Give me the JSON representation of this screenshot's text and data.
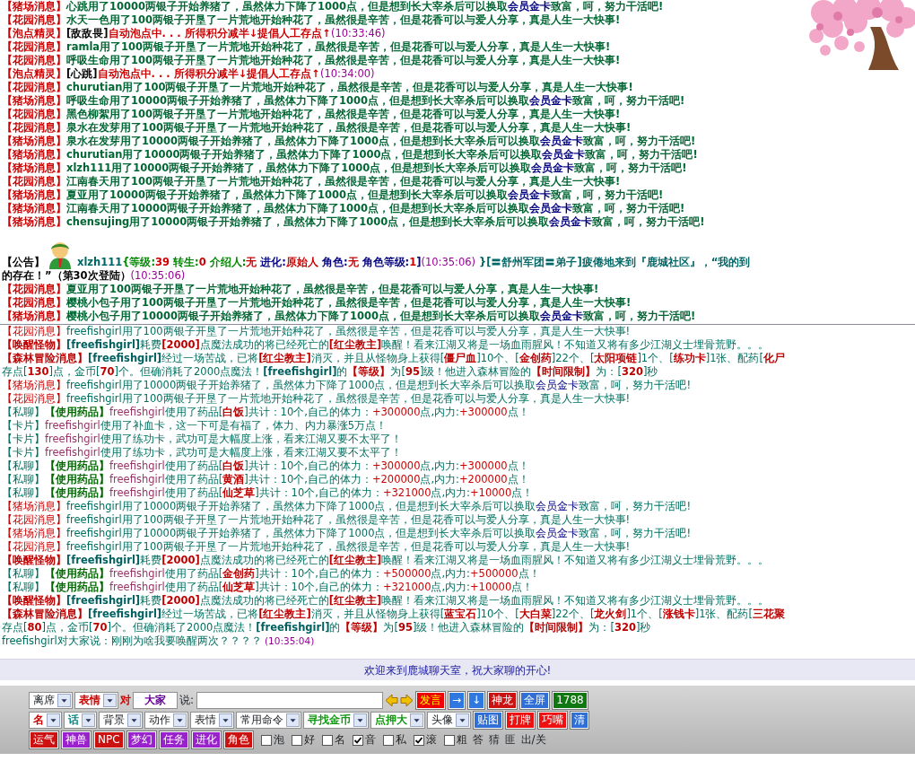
{
  "top_panel": {
    "items": [
      {
        "kind": "message",
        "parts": [
          {
            "text": "【猪场消息】",
            "kind": "tag"
          },
          {
            "text": "心跳用了10000两银子开始养猪了，虽然体力下降了1000点，但是想到长大宰杀后可以换取",
            "kind": "text"
          },
          {
            "text": "会员金卡",
            "kind": "gold"
          },
          {
            "text": "致富，呵，努力干活吧!",
            "kind": "text"
          }
        ]
      },
      {
        "kind": "message",
        "parts": [
          {
            "text": "【花园消息】",
            "kind": "tag"
          },
          {
            "text": "水天一色用了100两银子开垦了一片荒地开始种花了，虽然很是辛苦，但是花香可以与爱人分享，真是人生一大快事!",
            "kind": "text"
          }
        ]
      },
      {
        "kind": "message",
        "parts": [
          {
            "text": "【泡点精灵】",
            "kind": "tag"
          },
          {
            "text": "[敌敌畏]",
            "kind": "name"
          },
          {
            "text": "自动泡点中. . . 所得积分减半↓提倡人工存点↑",
            "kind": "alert"
          },
          {
            "text": "(10:33:46)",
            "kind": "time"
          }
        ]
      },
      {
        "kind": "message",
        "parts": [
          {
            "text": "【花园消息】",
            "kind": "tag"
          },
          {
            "text": "ramla用了100两银子开垦了一片荒地开始种花了，虽然很是辛苦，但是花香可以与爱人分享，真是人生一大快事!",
            "kind": "text"
          }
        ]
      },
      {
        "kind": "message",
        "parts": [
          {
            "text": "【花园消息】",
            "kind": "tag"
          },
          {
            "text": "呼吸生命用了100两银子开垦了一片荒地开始种花了，虽然很是辛苦，但是花香可以与爱人分享，真是人生一大快事!",
            "kind": "text"
          }
        ]
      },
      {
        "kind": "message",
        "parts": [
          {
            "text": "【泡点精灵】",
            "kind": "tag"
          },
          {
            "text": "[心跳]",
            "kind": "name"
          },
          {
            "text": "自动泡点中. . . 所得积分减半↓提倡人工存点↑",
            "kind": "alert"
          },
          {
            "text": "(10:34:00)",
            "kind": "time"
          }
        ]
      },
      {
        "kind": "message",
        "parts": [
          {
            "text": "【花园消息】",
            "kind": "tag"
          },
          {
            "text": "churutian用了100两银子开垦了一片荒地开始种花了，虽然很是辛苦，但是花香可以与爱人分享，真是人生一大快事!",
            "kind": "text"
          }
        ]
      },
      {
        "kind": "message",
        "parts": [
          {
            "text": "【猪场消息】",
            "kind": "tag"
          },
          {
            "text": "呼吸生命用了10000两银子开始养猪了，虽然体力下降了1000点，但是想到长大宰杀后可以换取",
            "kind": "text"
          },
          {
            "text": "会员金卡",
            "kind": "gold"
          },
          {
            "text": "致富，呵，努力干活吧!",
            "kind": "text"
          }
        ]
      },
      {
        "kind": "message",
        "parts": [
          {
            "text": "【花园消息】",
            "kind": "tag"
          },
          {
            "text": "黑色柳絮用了100两银子开垦了一片荒地开始种花了，虽然很是辛苦，但是花香可以与爱人分享，真是人生一大快事!",
            "kind": "text"
          }
        ]
      },
      {
        "kind": "message",
        "parts": [
          {
            "text": "【花园消息】",
            "kind": "tag"
          },
          {
            "text": "泉水在发芽用了100两银子开垦了一片荒地开始种花了，虽然很是辛苦，但是花香可以与爱人分享，真是人生一大快事!",
            "kind": "text"
          }
        ]
      },
      {
        "kind": "message",
        "parts": [
          {
            "text": "【猪场消息】",
            "kind": "tag"
          },
          {
            "text": "泉水在发芽用了10000两银子开始养猪了，虽然体力下降了1000点，但是想到长大宰杀后可以换取",
            "kind": "text"
          },
          {
            "text": "会员金卡",
            "kind": "gold"
          },
          {
            "text": "致富，呵，努力干活吧!",
            "kind": "text"
          }
        ]
      },
      {
        "kind": "message",
        "parts": [
          {
            "text": "【猪场消息】",
            "kind": "tag"
          },
          {
            "text": "churutian用了10000两银子开始养猪了，虽然体力下降了1000点，但是想到长大宰杀后可以换取",
            "kind": "text"
          },
          {
            "text": "会员金卡",
            "kind": "gold"
          },
          {
            "text": "致富，呵，努力干活吧!",
            "kind": "text"
          }
        ]
      },
      {
        "kind": "message",
        "parts": [
          {
            "text": "【猪场消息】",
            "kind": "tag"
          },
          {
            "text": "xlzh111用了10000两银子开始养猪了，虽然体力下降了1000点，但是想到长大宰杀后可以换取",
            "kind": "text"
          },
          {
            "text": "会员金卡",
            "kind": "gold"
          },
          {
            "text": "致富，呵，努力干活吧!",
            "kind": "text"
          }
        ]
      },
      {
        "kind": "message",
        "parts": [
          {
            "text": "【花园消息】",
            "kind": "tag"
          },
          {
            "text": "江南春天用了100两银子开垦了一片荒地开始种花了，虽然很是辛苦，但是花香可以与爱人分享，真是人生一大快事!",
            "kind": "text"
          }
        ]
      },
      {
        "kind": "message",
        "parts": [
          {
            "text": "【猪场消息】",
            "kind": "tag"
          },
          {
            "text": "夏亚用了10000两银子开始养猪了，虽然体力下降了1000点，但是想到长大宰杀后可以换取",
            "kind": "text"
          },
          {
            "text": "会员金卡",
            "kind": "gold"
          },
          {
            "text": "致富，呵，努力干活吧!",
            "kind": "text"
          }
        ]
      },
      {
        "kind": "message",
        "parts": [
          {
            "text": "【猪场消息】",
            "kind": "tag"
          },
          {
            "text": "江南春天用了10000两银子开始养猪了，虽然体力下降了1000点，但是想到长大宰杀后可以换取",
            "kind": "text"
          },
          {
            "text": "会员金卡",
            "kind": "gold"
          },
          {
            "text": "致富，呵，努力干活吧!",
            "kind": "text"
          }
        ]
      },
      {
        "kind": "message",
        "parts": [
          {
            "text": "【猪场消息】",
            "kind": "tag"
          },
          {
            "text": "chensujing用了10000两银子开始养猪了，虽然体力下降了1000点，但是想到长大宰杀后可以换取",
            "kind": "text"
          },
          {
            "text": "会员金卡",
            "kind": "gold"
          },
          {
            "text": "致富，呵，努力干活吧!",
            "kind": "text"
          }
        ]
      },
      {
        "kind": "announcement",
        "label": "【公告】",
        "lines": [
          {
            "parts": [
              {
                "text": "xlzh111",
                "kind": "user"
              },
              {
                "text": "{等级:",
                "kind": "label"
              },
              {
                "text": "39",
                "kind": "value"
              },
              {
                "text": " 转生:",
                "kind": "label"
              },
              {
                "text": "0",
                "kind": "value"
              },
              {
                "text": " 介绍人:",
                "kind": "label"
              },
              {
                "text": "无",
                "kind": "value"
              },
              {
                "text": " 进化:",
                "kind": "label2"
              },
              {
                "text": "原始人",
                "kind": "value"
              },
              {
                "text": " 角色:",
                "kind": "label2"
              },
              {
                "text": "无",
                "kind": "value"
              },
              {
                "text": " 角色等级:",
                "kind": "label2"
              },
              {
                "text": "1",
                "kind": "value"
              },
              {
                "text": "]",
                "kind": "label2"
              },
              {
                "text": "(10:35:06)",
                "kind": "time"
              },
              {
                "text": " }[〓舒州军团〓弟子]疲倦地来到『鹿城社区』，“我的到",
                "kind": "user"
              }
            ]
          },
          {
            "parts": [
              {
                "text": "的存在！”（第30次登陆）",
                "kind": "plain"
              },
              {
                "text": "(10:35:06)",
                "kind": "time"
              }
            ]
          }
        ]
      },
      {
        "kind": "message",
        "parts": [
          {
            "text": "【花园消息】",
            "kind": "tag"
          },
          {
            "text": "夏亚用了100两银子开垦了一片荒地开始种花了，虽然很是辛苦，但是花香可以与爱人分享，真是人生一大快事!",
            "kind": "text"
          }
        ]
      },
      {
        "kind": "message",
        "parts": [
          {
            "text": "【花园消息】",
            "kind": "tag"
          },
          {
            "text": "樱桃小包子用了100两银子开垦了一片荒地开始种花了，虽然很是辛苦，但是花香可以与爱人分享，真是人生一大快事!",
            "kind": "text"
          }
        ]
      },
      {
        "kind": "message",
        "parts": [
          {
            "text": "【猪场消息】",
            "kind": "tag"
          },
          {
            "text": "樱桃小包子用了10000两银子开始养猪了，虽然体力下降了1000点，但是想到长大宰杀后可以换取",
            "kind": "text"
          },
          {
            "text": "会员金卡",
            "kind": "gold"
          },
          {
            "text": "致富，呵，努力干活吧!",
            "kind": "text"
          }
        ]
      }
    ]
  },
  "chat_panel": {
    "messages": [
      {
        "parts": [
          {
            "text": "【花园消息】",
            "kind": "ltag"
          },
          {
            "text": "freefishgirl用了100两银子开垦了一片荒地开始种花了，虽然很是辛苦，但是花香可以与爱人分享，真是人生一大快事!",
            "kind": "ltext"
          }
        ]
      },
      {
        "parts": [
          {
            "text": "【唤醒怪物】",
            "kind": "lkey"
          },
          {
            "text": "[freefishgirl]",
            "kind": "lstrong"
          },
          {
            "text": "耗费",
            "kind": "ltext"
          },
          {
            "text": "[2000]",
            "kind": "lkey"
          },
          {
            "text": "点魔法成功的将已经死亡的",
            "kind": "ltext"
          },
          {
            "text": "[红尘教主]",
            "kind": "lkey"
          },
          {
            "text": "唤醒！看来江湖又将是一场血雨腥风！不知道又将有多少江湖义士埋骨荒野。。。",
            "kind": "ltext"
          }
        ]
      },
      {
        "parts": [
          {
            "text": "【森林冒险消息】",
            "kind": "lkey"
          },
          {
            "text": "[freefishgirl]",
            "kind": "lstrong"
          },
          {
            "text": "经过一场苦战，已将",
            "kind": "ltext"
          },
          {
            "text": "[红尘教主]",
            "kind": "lkey"
          },
          {
            "text": "消灭，并且从怪物身上获得[",
            "kind": "ltext"
          },
          {
            "text": "僵尸血",
            "kind": "lkey"
          },
          {
            "text": "]10个、[",
            "kind": "ltext"
          },
          {
            "text": "金创药",
            "kind": "lkey"
          },
          {
            "text": "]22个、[",
            "kind": "ltext"
          },
          {
            "text": "太阳项链",
            "kind": "lkey"
          },
          {
            "text": "]1个、[",
            "kind": "ltext"
          },
          {
            "text": "练功卡",
            "kind": "lkey"
          },
          {
            "text": "]1张、配药[",
            "kind": "ltext"
          },
          {
            "text": "化尸",
            "kind": "lkey"
          }
        ]
      },
      {
        "parts": [
          {
            "text": "存点[",
            "kind": "ltext"
          },
          {
            "text": "130",
            "kind": "lkey"
          },
          {
            "text": "]点，金币[",
            "kind": "ltext"
          },
          {
            "text": "70",
            "kind": "lkey"
          },
          {
            "text": "]个。但确消耗了2000点魔法！",
            "kind": "ltext"
          },
          {
            "text": "[freefishgirl]",
            "kind": "lstrong"
          },
          {
            "text": "的",
            "kind": "ltext"
          },
          {
            "text": "【等级】",
            "kind": "lkey"
          },
          {
            "text": "为[",
            "kind": "ltext"
          },
          {
            "text": "95",
            "kind": "lkey"
          },
          {
            "text": "]级！他进入森林冒险的",
            "kind": "ltext"
          },
          {
            "text": "【时间限制】",
            "kind": "lkey"
          },
          {
            "text": "为：[",
            "kind": "ltext"
          },
          {
            "text": "320",
            "kind": "lkey"
          },
          {
            "text": "]秒",
            "kind": "ltext"
          }
        ]
      },
      {
        "parts": [
          {
            "text": "【猪场消息】",
            "kind": "ltag"
          },
          {
            "text": "freefishgirl用了10000两银子开始养猪了，虽然体力下降了1000点，但是想到长大宰杀后可以换取",
            "kind": "ltext"
          },
          {
            "text": "会员金卡",
            "kind": "lgold"
          },
          {
            "text": "致富，呵，努力干活吧!",
            "kind": "ltext"
          }
        ]
      },
      {
        "parts": [
          {
            "text": "【花园消息】",
            "kind": "ltag"
          },
          {
            "text": "freefishgirl用了100两银子开垦了一片荒地开始种花了，虽然很是辛苦，但是花香可以与爱人分享，真是人生一大快事!",
            "kind": "ltext"
          }
        ]
      },
      {
        "parts": [
          {
            "text": "【私聊】",
            "kind": "ltext"
          },
          {
            "text": "【使用药品】",
            "kind": "lmed"
          },
          {
            "text": "freefishgirl",
            "kind": "lplayer"
          },
          {
            "text": "使用了药品[",
            "kind": "ltext"
          },
          {
            "text": "白饭",
            "kind": "lkey"
          },
          {
            "text": "]共计：10个,自己的体力：",
            "kind": "ltext"
          },
          {
            "text": "+300000",
            "kind": "lnum"
          },
          {
            "text": "点,内力:",
            "kind": "ltext"
          },
          {
            "text": "+300000",
            "kind": "lnum"
          },
          {
            "text": "点！",
            "kind": "ltext"
          }
        ]
      },
      {
        "parts": [
          {
            "text": "【卡片】",
            "kind": "ltext"
          },
          {
            "text": "freefishgirl",
            "kind": "lplayer"
          },
          {
            "text": "使用了补血卡，这一下可是有福了，体力、内力暴涨5万点！",
            "kind": "ltext"
          }
        ]
      },
      {
        "parts": [
          {
            "text": "【卡片】",
            "kind": "ltext"
          },
          {
            "text": "freefishgirl",
            "kind": "lplayer"
          },
          {
            "text": "使用了练功卡，武功可是大幅度上涨，看来江湖又要不太平了！",
            "kind": "ltext"
          }
        ]
      },
      {
        "parts": [
          {
            "text": "【卡片】",
            "kind": "ltext"
          },
          {
            "text": "freefishgirl",
            "kind": "lplayer"
          },
          {
            "text": "使用了练功卡，武功可是大幅度上涨，看来江湖又要不太平了！",
            "kind": "ltext"
          }
        ]
      },
      {
        "parts": [
          {
            "text": "【私聊】",
            "kind": "ltext"
          },
          {
            "text": "【使用药品】",
            "kind": "lmed"
          },
          {
            "text": "freefishgirl",
            "kind": "lplayer"
          },
          {
            "text": "使用了药品[",
            "kind": "ltext"
          },
          {
            "text": "白饭",
            "kind": "lkey"
          },
          {
            "text": "]共计：10个,自己的体力：",
            "kind": "ltext"
          },
          {
            "text": "+300000",
            "kind": "lnum"
          },
          {
            "text": "点,内力:",
            "kind": "ltext"
          },
          {
            "text": "+300000",
            "kind": "lnum"
          },
          {
            "text": "点！",
            "kind": "ltext"
          }
        ]
      },
      {
        "parts": [
          {
            "text": "【私聊】",
            "kind": "ltext"
          },
          {
            "text": "【使用药品】",
            "kind": "lmed"
          },
          {
            "text": "freefishgirl",
            "kind": "lplayer"
          },
          {
            "text": "使用了药品[",
            "kind": "ltext"
          },
          {
            "text": "黄酒",
            "kind": "lkey"
          },
          {
            "text": "]共计：10个,自己的体力：",
            "kind": "ltext"
          },
          {
            "text": "+200000",
            "kind": "lnum"
          },
          {
            "text": "点,内力:",
            "kind": "ltext"
          },
          {
            "text": "+200000",
            "kind": "lnum"
          },
          {
            "text": "点！",
            "kind": "ltext"
          }
        ]
      },
      {
        "parts": [
          {
            "text": "【私聊】",
            "kind": "ltext"
          },
          {
            "text": "【使用药品】",
            "kind": "lmed"
          },
          {
            "text": "freefishgirl",
            "kind": "lplayer"
          },
          {
            "text": "使用了药品[",
            "kind": "ltext"
          },
          {
            "text": "仙芝草",
            "kind": "lkey"
          },
          {
            "text": "]共计：10个,自己的体力：",
            "kind": "ltext"
          },
          {
            "text": "+321000",
            "kind": "lnum"
          },
          {
            "text": "点,内力:",
            "kind": "ltext"
          },
          {
            "text": "+10000",
            "kind": "lnum"
          },
          {
            "text": "点！",
            "kind": "ltext"
          }
        ]
      },
      {
        "parts": [
          {
            "text": "【猪场消息】",
            "kind": "ltag"
          },
          {
            "text": "freefishgirl用了10000两银子开始养猪了，虽然体力下降了1000点，但是想到长大宰杀后可以换取",
            "kind": "ltext"
          },
          {
            "text": "会员金卡",
            "kind": "lgold"
          },
          {
            "text": "致富，呵，努力干活吧!",
            "kind": "ltext"
          }
        ]
      },
      {
        "parts": [
          {
            "text": "【花园消息】",
            "kind": "ltag"
          },
          {
            "text": "freefishgirl用了100两银子开垦了一片荒地开始种花了，虽然很是辛苦，但是花香可以与爱人分享，真是人生一大快事!",
            "kind": "ltext"
          }
        ]
      },
      {
        "parts": [
          {
            "text": "【猪场消息】",
            "kind": "ltag"
          },
          {
            "text": "freefishgirl用了10000两银子开始养猪了，虽然体力下降了1000点，但是想到长大宰杀后可以换取",
            "kind": "ltext"
          },
          {
            "text": "会员金卡",
            "kind": "lgold"
          },
          {
            "text": "致富，呵，努力干活吧!",
            "kind": "ltext"
          }
        ]
      },
      {
        "parts": [
          {
            "text": "【花园消息】",
            "kind": "ltag"
          },
          {
            "text": "freefishgirl用了100两银子开垦了一片荒地开始种花了，虽然很是辛苦，但是花香可以与爱人分享，真是人生一大快事!",
            "kind": "ltext"
          }
        ]
      },
      {
        "parts": [
          {
            "text": "【唤醒怪物】",
            "kind": "lkey"
          },
          {
            "text": "[freefishgirl]",
            "kind": "lstrong"
          },
          {
            "text": "耗费",
            "kind": "ltext"
          },
          {
            "text": "[2000]",
            "kind": "lkey"
          },
          {
            "text": "点魔法成功的将已经死亡的",
            "kind": "ltext"
          },
          {
            "text": "[红尘教主]",
            "kind": "lkey"
          },
          {
            "text": "唤醒！看来江湖又将是一场血雨腥风！不知道又将有多少江湖义士埋骨荒野。。。",
            "kind": "ltext"
          }
        ]
      },
      {
        "parts": [
          {
            "text": "【私聊】",
            "kind": "ltext"
          },
          {
            "text": "【使用药品】",
            "kind": "lmed"
          },
          {
            "text": "freefishgirl",
            "kind": "lplayer"
          },
          {
            "text": "使用了药品[",
            "kind": "ltext"
          },
          {
            "text": "金创药",
            "kind": "lkey"
          },
          {
            "text": "]共计：10个,自己的体力：",
            "kind": "ltext"
          },
          {
            "text": "+500000",
            "kind": "lnum"
          },
          {
            "text": "点,内力:",
            "kind": "ltext"
          },
          {
            "text": "+500000",
            "kind": "lnum"
          },
          {
            "text": "点！",
            "kind": "ltext"
          }
        ]
      },
      {
        "parts": [
          {
            "text": "【私聊】",
            "kind": "ltext"
          },
          {
            "text": "【使用药品】",
            "kind": "lmed"
          },
          {
            "text": "freefishgirl",
            "kind": "lplayer"
          },
          {
            "text": "使用了药品[",
            "kind": "ltext"
          },
          {
            "text": "仙芝草",
            "kind": "lkey"
          },
          {
            "text": "]共计：10个,自己的体力：",
            "kind": "ltext"
          },
          {
            "text": "+321000",
            "kind": "lnum"
          },
          {
            "text": "点,内力:",
            "kind": "ltext"
          },
          {
            "text": "+10000",
            "kind": "lnum"
          },
          {
            "text": "点！",
            "kind": "ltext"
          }
        ]
      },
      {
        "parts": [
          {
            "text": "【唤醒怪物】",
            "kind": "lkey"
          },
          {
            "text": "[freefishgirl]",
            "kind": "lstrong"
          },
          {
            "text": "耗费",
            "kind": "ltext"
          },
          {
            "text": "[2000]",
            "kind": "lkey"
          },
          {
            "text": "点魔法成功的将已经死亡的",
            "kind": "ltext"
          },
          {
            "text": "[红尘教主]",
            "kind": "lkey"
          },
          {
            "text": "唤醒！看来江湖又将是一场血雨腥风！不知道又将有多少江湖义士埋骨荒野。。。",
            "kind": "ltext"
          }
        ]
      },
      {
        "parts": [
          {
            "text": "【森林冒险消息】",
            "kind": "lkey"
          },
          {
            "text": "[freefishgirl]",
            "kind": "lstrong"
          },
          {
            "text": "经过一场苦战，已将",
            "kind": "ltext"
          },
          {
            "text": "[红尘教主]",
            "kind": "lkey"
          },
          {
            "text": "消灭，并且从怪物身上获得[",
            "kind": "ltext"
          },
          {
            "text": "蓝宝石",
            "kind": "lkey"
          },
          {
            "text": "]10个、[",
            "kind": "ltext"
          },
          {
            "text": "大白菜",
            "kind": "lkey"
          },
          {
            "text": "]22个、[",
            "kind": "ltext"
          },
          {
            "text": "龙火剑",
            "kind": "lkey"
          },
          {
            "text": "]1个、[",
            "kind": "ltext"
          },
          {
            "text": "涨钱卡",
            "kind": "lkey"
          },
          {
            "text": "]1张、配药[",
            "kind": "ltext"
          },
          {
            "text": "三花聚",
            "kind": "lkey"
          }
        ]
      },
      {
        "parts": [
          {
            "text": "存点[",
            "kind": "ltext"
          },
          {
            "text": "80",
            "kind": "lkey"
          },
          {
            "text": "]点，金币[",
            "kind": "ltext"
          },
          {
            "text": "70",
            "kind": "lkey"
          },
          {
            "text": "]个。但确消耗了2000点魔法！",
            "kind": "ltext"
          },
          {
            "text": "[freefishgirl]",
            "kind": "lstrong"
          },
          {
            "text": "的",
            "kind": "ltext"
          },
          {
            "text": "【等级】",
            "kind": "lkey"
          },
          {
            "text": "为[",
            "kind": "ltext"
          },
          {
            "text": "95",
            "kind": "lkey"
          },
          {
            "text": "]级！他进入森林冒险的",
            "kind": "ltext"
          },
          {
            "text": "【时间限制】",
            "kind": "lkey"
          },
          {
            "text": "为：[",
            "kind": "ltext"
          },
          {
            "text": "320",
            "kind": "lkey"
          },
          {
            "text": "]秒",
            "kind": "ltext"
          }
        ]
      },
      {
        "parts": [
          {
            "text": "freefishgirl对大家说：刚刚为啥我要唤醒两次？？？？",
            "kind": "ltext"
          },
          {
            "text": " (10:35:04)",
            "kind": "ltime"
          }
        ]
      }
    ]
  },
  "welcome": "欢迎来到鹿城聊天室，祝大家聊的开心!",
  "toolbar": {
    "rows": [
      {
        "items": [
          {
            "kind": "select",
            "label": "离席"
          },
          {
            "kind": "select",
            "label": "表情",
            "color": "#cc0000"
          },
          {
            "kind": "text",
            "label": "对",
            "color": "#cc0000"
          },
          {
            "kind": "field",
            "value": "大家",
            "color": "#660099"
          },
          {
            "kind": "text",
            "label": "说:"
          },
          {
            "kind": "input"
          },
          {
            "kind": "arrow_left"
          },
          {
            "kind": "arrow_right"
          },
          {
            "kind": "alert_button",
            "label": "发言",
            "color": "#ee0000"
          },
          {
            "kind": "button",
            "label": "→",
            "color": "#2f78e0"
          },
          {
            "kind": "button",
            "label": "↓",
            "color": "#2f78e0"
          },
          {
            "kind": "button",
            "label": "神龙",
            "color": "#cc1111"
          },
          {
            "kind": "button",
            "label": "全屏",
            "color": "#2f6fd6"
          },
          {
            "kind": "button",
            "label": "1788",
            "color": "#117711"
          }
        ]
      },
      {
        "items": [
          {
            "kind": "select",
            "label": "名",
            "color": "#cc0000"
          },
          {
            "kind": "select",
            "label": "话",
            "color": "#008080"
          },
          {
            "kind": "select",
            "label": "背景"
          },
          {
            "kind": "select",
            "label": "动作"
          },
          {
            "kind": "select",
            "label": "表情"
          },
          {
            "kind": "select",
            "label": "常用命令"
          },
          {
            "kind": "select",
            "label": "寻找金币",
            "color": "#119911"
          },
          {
            "kind": "select",
            "label": "点押大",
            "color": "#119911"
          },
          {
            "kind": "select",
            "label": "头像"
          },
          {
            "kind": "button",
            "label": "贴图",
            "color": "#2f6fd6"
          },
          {
            "kind": "button",
            "label": "打牌",
            "color": "#ee1111"
          },
          {
            "kind": "button",
            "label": "巧嘴",
            "color": "#ee1111"
          },
          {
            "kind": "button",
            "label": "清",
            "color": "#2f6fd6"
          }
        ]
      },
      {
        "items": [
          {
            "kind": "button",
            "label": "运气",
            "color": "#cc1111"
          },
          {
            "kind": "button",
            "label": "神兽",
            "color": "#9922cc"
          },
          {
            "kind": "button",
            "label": "NPC",
            "color": "#cc1111"
          },
          {
            "kind": "button",
            "label": "梦幻",
            "color": "#9922cc"
          },
          {
            "kind": "button",
            "label": "任务",
            "color": "#9922cc"
          },
          {
            "kind": "button",
            "label": "进化",
            "color": "#9922cc"
          },
          {
            "kind": "button",
            "label": "角色",
            "color": "#cc1111"
          },
          {
            "kind": "checkbox",
            "label": "泡",
            "checked": false
          },
          {
            "kind": "checkbox",
            "label": "好",
            "checked": false
          },
          {
            "kind": "checkbox",
            "label": "名",
            "checked": false
          },
          {
            "kind": "checkbox",
            "label": "音",
            "checked": true
          },
          {
            "kind": "checkbox",
            "label": "私",
            "checked": false
          },
          {
            "kind": "checkbox",
            "label": "滚",
            "checked": true
          },
          {
            "kind": "checkbox",
            "label": "粗",
            "checked": false
          },
          {
            "kind": "link",
            "label": "答"
          },
          {
            "kind": "link",
            "label": "猜"
          },
          {
            "kind": "link",
            "label": "匪"
          },
          {
            "kind": "link",
            "label": "出/关"
          }
        ]
      }
    ]
  }
}
